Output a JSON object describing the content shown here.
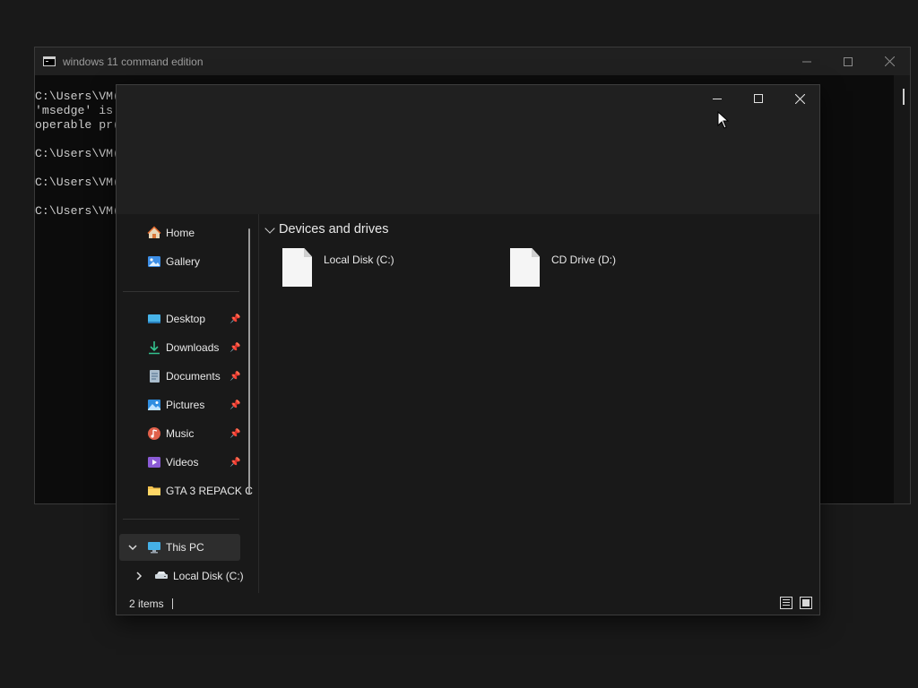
{
  "console": {
    "title": "windows 11 command edition",
    "lines": "C:\\Users\\VM(\n'msedge' is\noperable pr(\n\nC:\\Users\\VM(\n\nC:\\Users\\VM(\n\nC:\\Users\\VM("
  },
  "explorer": {
    "sidebar": {
      "top_items": [
        {
          "label": "Home",
          "icon": "home-icon"
        },
        {
          "label": "Gallery",
          "icon": "gallery-icon"
        }
      ],
      "quick_access": [
        {
          "label": "Desktop",
          "icon": "desktop-icon",
          "pinned": true
        },
        {
          "label": "Downloads",
          "icon": "download-icon",
          "pinned": true
        },
        {
          "label": "Documents",
          "icon": "documents-icon",
          "pinned": true
        },
        {
          "label": "Pictures",
          "icon": "pictures-icon",
          "pinned": true
        },
        {
          "label": "Music",
          "icon": "music-icon",
          "pinned": true
        },
        {
          "label": "Videos",
          "icon": "videos-icon",
          "pinned": true
        },
        {
          "label": "GTA 3 REPACK C",
          "icon": "folder-icon",
          "pinned": false
        }
      ],
      "this_pc": {
        "label": "This PC",
        "icon": "this-pc-icon"
      },
      "local_disk": {
        "label": "Local Disk (C:)",
        "icon": "drive-icon"
      }
    },
    "main": {
      "group_title": "Devices and drives",
      "drives": [
        {
          "label": "Local Disk (C:)"
        },
        {
          "label": "CD Drive (D:)"
        }
      ]
    },
    "status": {
      "item_count": "2 items"
    }
  }
}
